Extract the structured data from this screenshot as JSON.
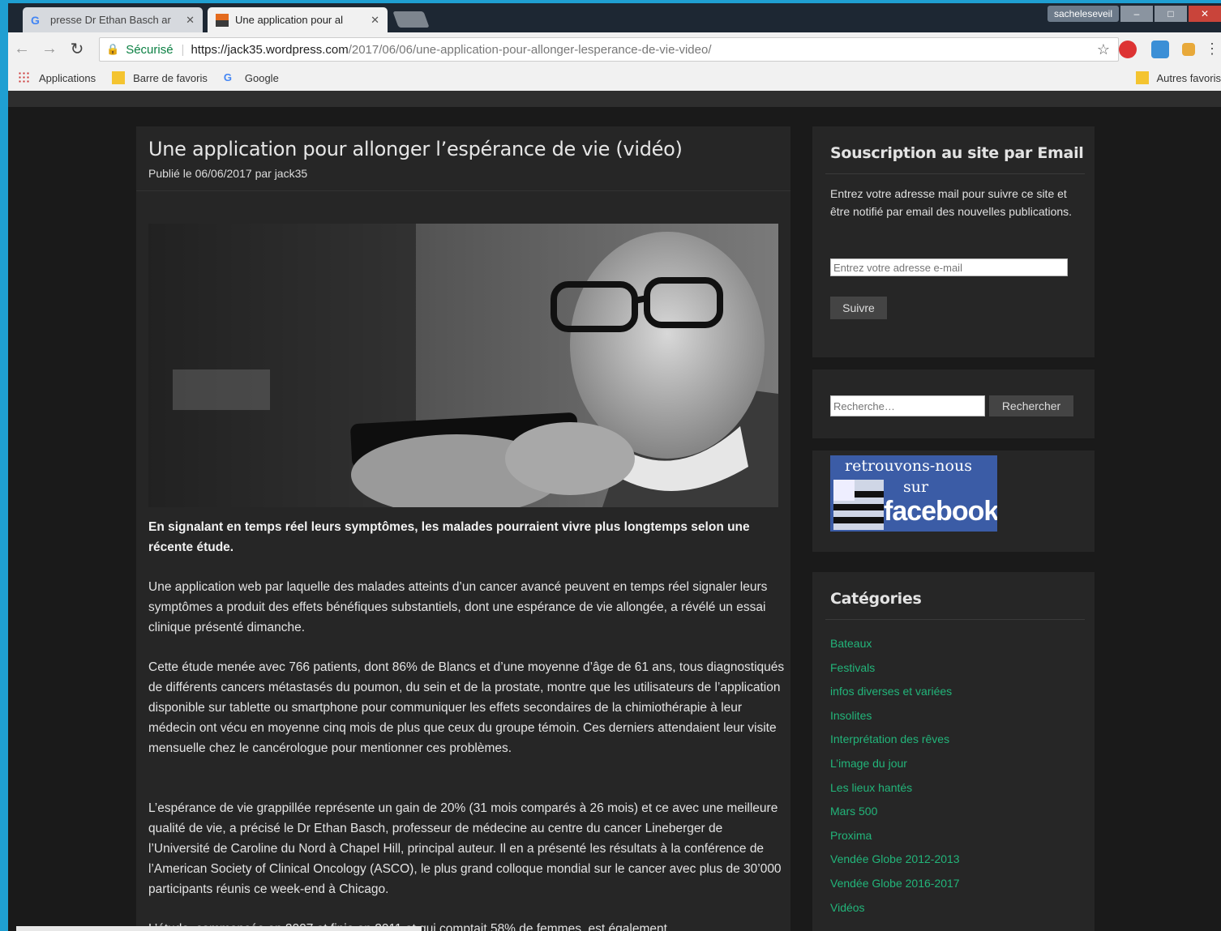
{
  "browser": {
    "tabs": [
      {
        "title": "presse Dr Ethan Basch ar",
        "active": false
      },
      {
        "title": "Une application pour al",
        "active": true
      }
    ],
    "user_chip": "sacheleseveil",
    "window_buttons": {
      "minimize": "–",
      "maximize": "□",
      "close": "✕"
    },
    "secure_label": "Sécurisé",
    "url_host": "https://jack35.wordpress.com",
    "url_path": "/2017/06/06/une-application-pour-allonger-lesperance-de-vie-video/",
    "bookmarks": [
      {
        "label": "Applications",
        "icon": "apps-grid-icon"
      },
      {
        "label": "Barre de favoris",
        "icon": "folder-icon"
      },
      {
        "label": "Google",
        "icon": "google-icon"
      }
    ],
    "other_bookmarks": "Autres favoris"
  },
  "article": {
    "title": "Une application pour allonger l’espérance de vie (vidéo)",
    "published_prefix": "Publié le",
    "date": "06/06/2017",
    "by": "par",
    "author": "jack35",
    "lead": "En signalant en temps réel leurs symptômes, les malades pourraient vivre plus longtemps selon une récente étude.",
    "paragraphs": [
      "Une application web par laquelle des malades atteints d’un cancer avancé peuvent en temps réel signaler leurs symptômes a produit des effets bénéfiques substantiels, dont une espérance de vie allongée, a révélé un essai clinique présenté dimanche.",
      "Cette étude menée avec 766 patients, dont 86% de Blancs et d’une moyenne d’âge de 61 ans, tous diagnostiqués de différents cancers métastasés du poumon, du sein et de la prostate, montre que les utilisateurs de l’application disponible sur tablette ou smartphone pour communiquer les effets secondaires de la chimiothérapie à leur médecin ont vécu en moyenne cinq mois de plus que ceux du groupe témoin. Ces derniers attendaient leur visite mensuelle chez le cancérologue pour mentionner ces problèmes.",
      "L’espérance de vie grappillée représente un gain de 20% (31 mois comparés à 26 mois) et ce avec une meilleure qualité de vie, a précisé le Dr Ethan Basch, professeur de médecine au centre du cancer Lineberger de l’Université de Caroline du Nord à Chapel Hill, principal auteur. Il en a présenté les résultats à la conférence de l’American Society of Clinical Oncology (ASCO), le plus grand colloque mondial sur le cancer avec plus de 30’000 participants réunis ce week-end à Chicago.",
      "L’étude, commencée en 2007 et finie en 2011 et qui comptait 58% de femmes, est également"
    ]
  },
  "sidebar": {
    "subscribe": {
      "title": "Souscription au site par Email",
      "text": "Entrez votre adresse mail pour suivre ce site et être notifié par email des nouvelles publications.",
      "placeholder": "Entrez votre adresse e-mail",
      "button": "Suivre"
    },
    "search": {
      "placeholder": "Recherche…",
      "button": "Rechercher"
    },
    "facebook": {
      "line1": "retrouvons-nous",
      "line2": "sur",
      "line3": "facebook"
    },
    "categories": {
      "title": "Catégories",
      "items": [
        "Bateaux",
        "Festivals",
        "infos diverses et variées",
        "Insolites",
        "Interprétation des rêves",
        "L’image du jour",
        "Les lieux hantés",
        "Mars 500",
        "Proxima",
        "Vendée Globe 2012-2013",
        "Vendée Globe 2016-2017",
        "Vidéos"
      ]
    }
  },
  "colors": {
    "link": "#22b57a",
    "page_bg": "#1a1a1a",
    "panel_bg": "#262626",
    "desktop": "#1f9fd2"
  }
}
